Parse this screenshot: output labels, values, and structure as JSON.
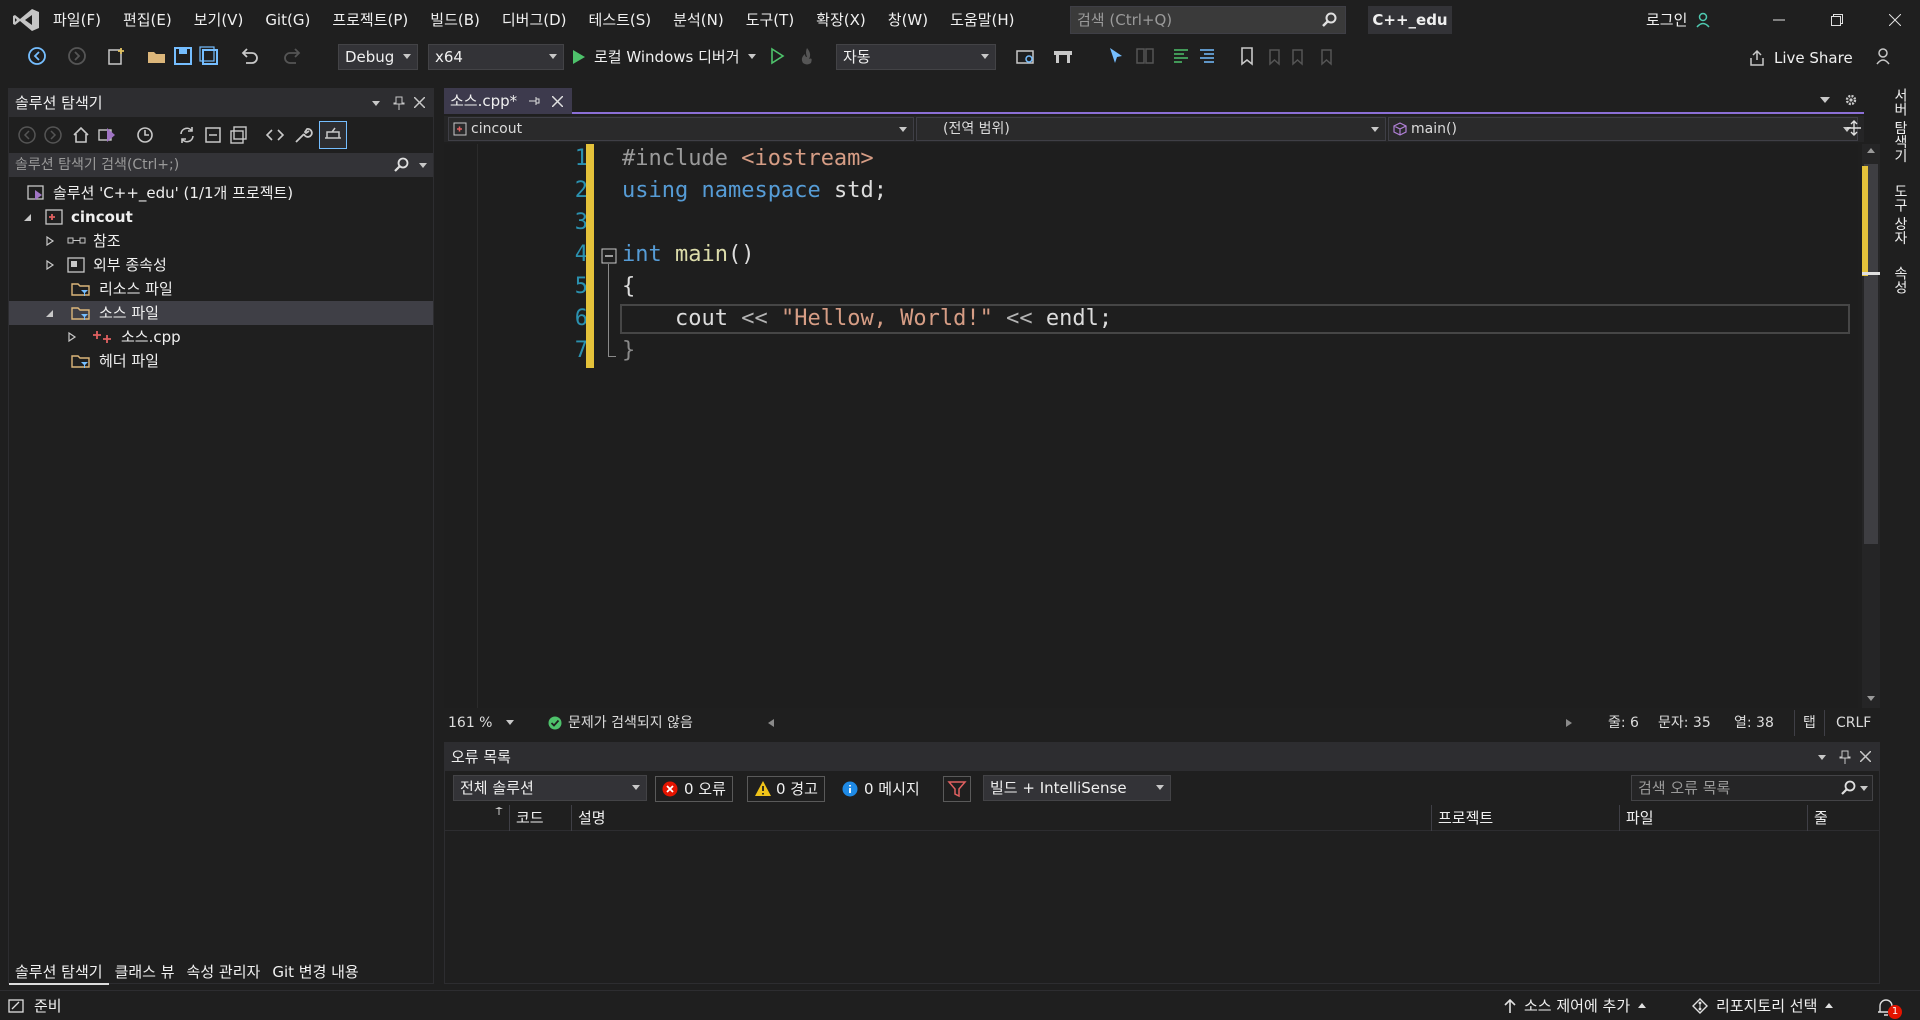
{
  "menu": {
    "items": [
      "파일(F)",
      "편집(E)",
      "보기(V)",
      "Git(G)",
      "프로젝트(P)",
      "빌드(B)",
      "디버그(D)",
      "테스트(S)",
      "분석(N)",
      "도구(T)",
      "확장(X)",
      "창(W)",
      "도움말(H)"
    ],
    "search_placeholder": "검색 (Ctrl+Q)",
    "project_name": "C++_edu",
    "login": "로그인"
  },
  "toolbar": {
    "config": "Debug",
    "platform": "x64",
    "run_label": "로컬 Windows 디버거",
    "run_mode": "자동",
    "live_share": "Live Share"
  },
  "solution_explorer": {
    "title": "솔루션 탐색기",
    "search_placeholder": "솔루션 탐색기 검색(Ctrl+;)",
    "tree": [
      {
        "label": "솔루션 'C++_edu' (1/1개 프로젝트)"
      },
      {
        "label": "cincout"
      },
      {
        "label": "참조"
      },
      {
        "label": "외부 종속성"
      },
      {
        "label": "리소스 파일"
      },
      {
        "label": "소스 파일"
      },
      {
        "label": "소스.cpp"
      },
      {
        "label": "헤더 파일"
      }
    ],
    "tabs": [
      "솔루션 탐색기",
      "클래스 뷰",
      "속성 관리자",
      "Git 변경 내용"
    ]
  },
  "editor": {
    "tab_title": "소스.cpp*",
    "nav": {
      "project": "cincout",
      "scope": "(전역 범위)",
      "member": "main()"
    },
    "line_numbers": [
      "1",
      "2",
      "3",
      "4",
      "5",
      "6",
      "7"
    ],
    "code": {
      "l1_pp": "#include",
      "l1_inc": "<iostream>",
      "l2_kw1": "using",
      "l2_kw2": "namespace",
      "l2_rest": "std;",
      "l4_kw": "int",
      "l4_fn": "main",
      "l4_rest": "()",
      "l5": "{",
      "l6_a": "cout",
      "l6_op1": "<<",
      "l6_str": "\"Hellow, World!\"",
      "l6_op2": "<<",
      "l6_b": "endl;",
      "l7": "}"
    },
    "zoom": "161 %",
    "no_issues": "문제가 검색되지 않음",
    "line": "줄: 6",
    "char": "문자: 35",
    "col": "열: 38",
    "tab_mode": "탭",
    "eol": "CRLF"
  },
  "error_list": {
    "title": "오류 목록",
    "scope": "전체 솔루션",
    "errors": "0 오류",
    "warnings": "0 경고",
    "messages": "0 메시지",
    "build_filter": "빌드 + IntelliSense",
    "search_placeholder": "검색 오류 목록",
    "columns": [
      "코드",
      "설명",
      "프로젝트",
      "파일",
      "줄"
    ]
  },
  "right_tabs": [
    "서버 탐색기",
    "도구 상자",
    "속성"
  ],
  "statusbar": {
    "ready": "준비",
    "source_control": "소스 제어에 추가",
    "repo": "리포지토리 선택",
    "notifications": "1"
  },
  "colors": {
    "accent": "#8b6fd6",
    "change_bar": "#e4c23a",
    "keyword": "#569cd6",
    "string": "#d69d85",
    "line_number": "#2b91af"
  }
}
